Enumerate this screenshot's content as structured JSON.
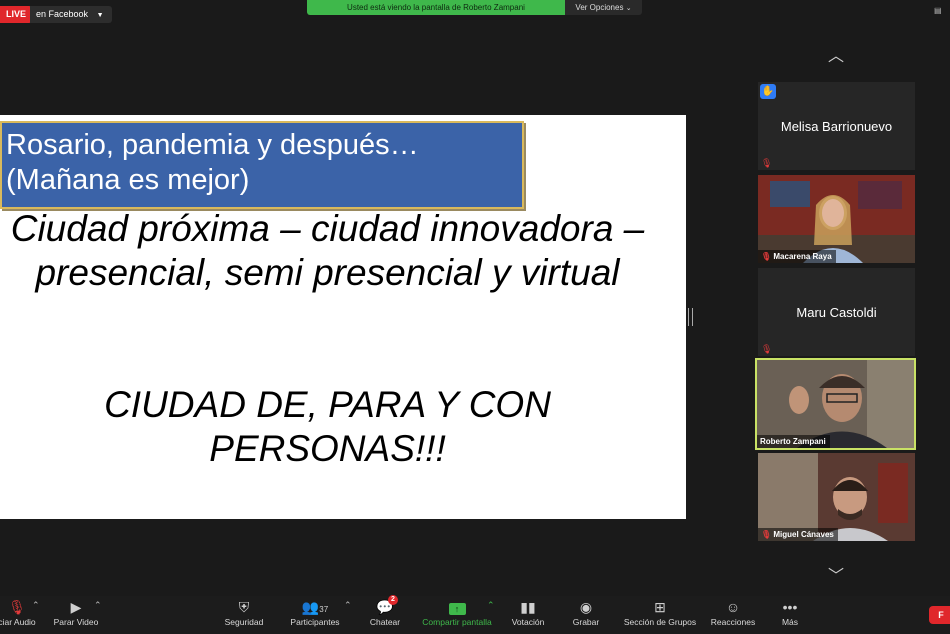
{
  "top_bar": {
    "live_label": "LIVE",
    "stream_target": "en Facebook",
    "share_banner": "Usted está viendo la pantalla de Roberto Zampani",
    "view_options": "Ver Opciones"
  },
  "slide": {
    "title": "Rosario, pandemia y después…\n(Mañana es mejor)",
    "body": "Ciudad próxima – ciudad innovadora – presencial, semi presencial y virtual",
    "caps": "CIUDAD DE, PARA Y CON PERSONAS!!!"
  },
  "gallery": {
    "participants": [
      {
        "name": "Melisa Barrionuevo",
        "video": false,
        "hand_raised": true,
        "muted": true
      },
      {
        "name": "Macarena Raya",
        "video": true,
        "muted": true
      },
      {
        "name": "Maru Castoldi",
        "video": false,
        "muted": true
      },
      {
        "name": "Roberto Zampani",
        "video": true,
        "muted": false,
        "active_speaker": true
      },
      {
        "name": "Miguel Cánaves",
        "video": true,
        "muted": true
      }
    ]
  },
  "toolbar": {
    "audio": "Iniciar Audio",
    "audio_visible": "ciar Audio",
    "video": "Parar Video",
    "security": "Seguridad",
    "participants": "Participantes",
    "participants_count": "37",
    "chat": "Chatear",
    "chat_badge": "2",
    "share": "Compartir pantalla",
    "polls": "Votación",
    "record": "Grabar",
    "breakout": "Sección de Grupos",
    "reactions": "Reacciones",
    "more": "Más",
    "end_visible": "F"
  },
  "colors": {
    "live_red": "#e0272b",
    "share_green": "#3fb84b",
    "active_speaker_border": "#c9e265",
    "slide_title_bg": "#3b63a8"
  }
}
